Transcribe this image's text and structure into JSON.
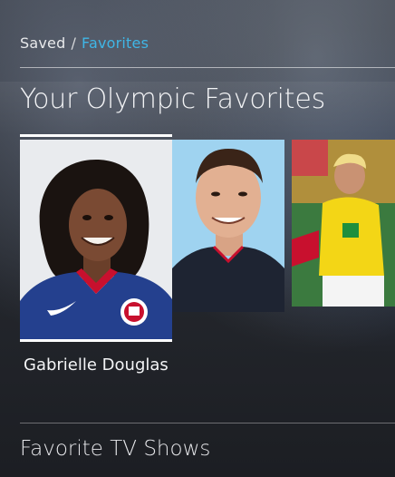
{
  "breadcrumb": {
    "root": "Saved",
    "separator": "/",
    "current": "Favorites"
  },
  "sections": {
    "favorites_title": "Your Olympic Favorites",
    "tv_title": "Favorite TV Shows"
  },
  "favorites": [
    {
      "name": "Gabrielle Douglas",
      "focused": true
    }
  ],
  "colors": {
    "accent": "#3fb6e6",
    "background": "#23262c"
  }
}
